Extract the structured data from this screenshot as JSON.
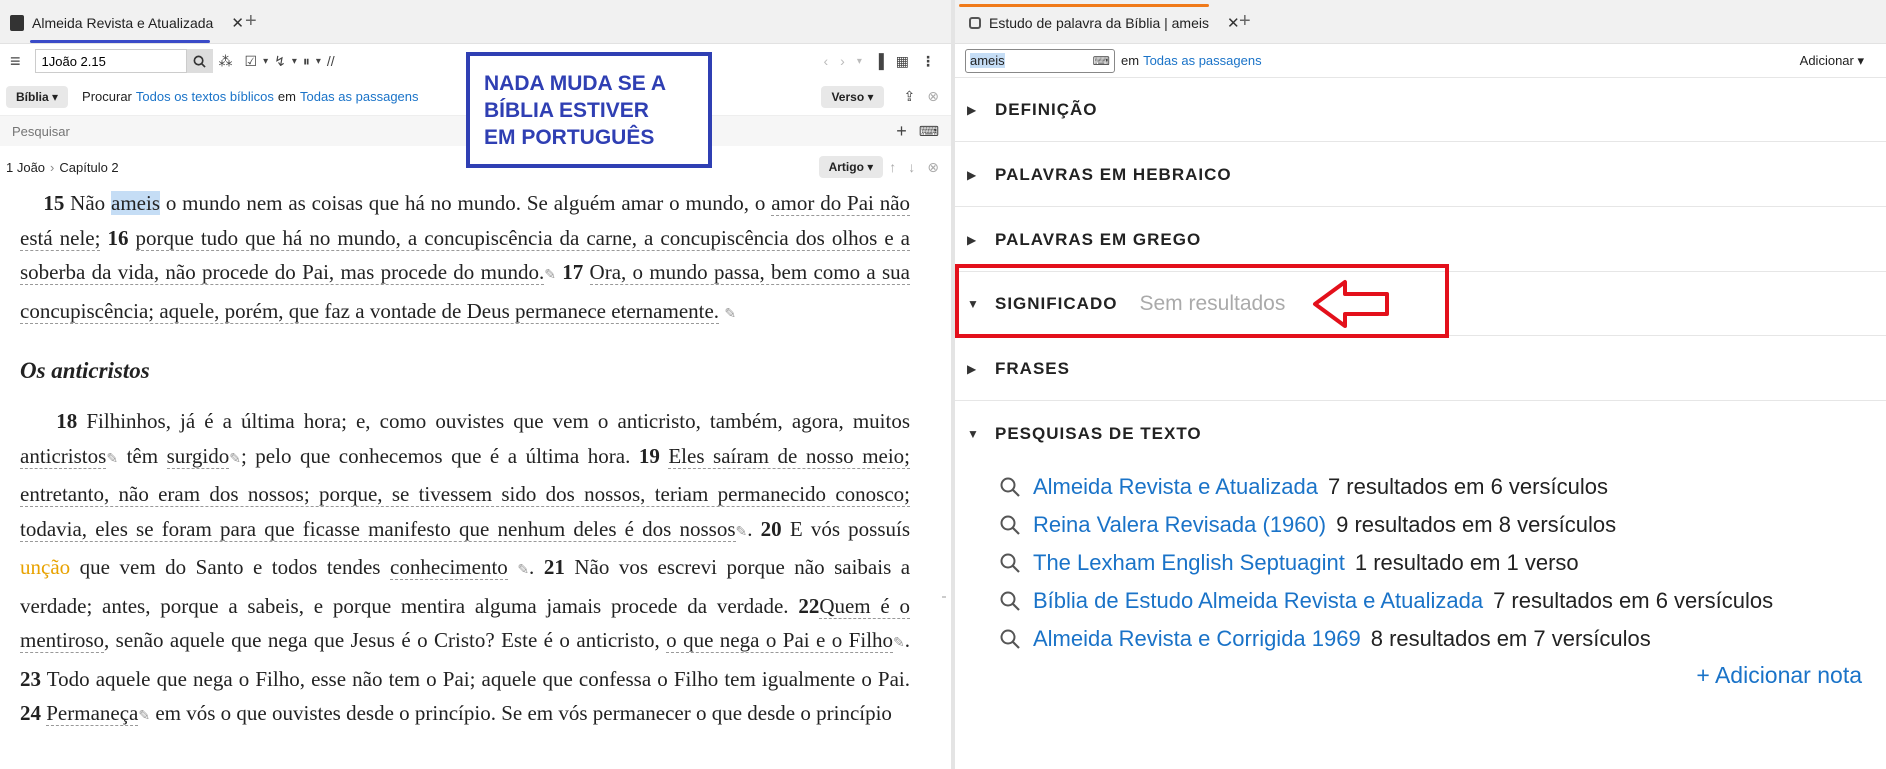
{
  "left": {
    "tab_title": "Almeida Revista e Atualizada",
    "tab_close": "✕",
    "reference": "1João 2.15",
    "toolbar_separator": "//",
    "search_bar": {
      "scope_button": "Bíblia",
      "procurar": "Procurar",
      "search_texts": "Todos os textos bíblicos",
      "em": "em",
      "passages": "Todas as passagens",
      "view_button": "Verso"
    },
    "search_placeholder": "Pesquisar",
    "breadcrumb": {
      "book": "1 João",
      "chapter": "Capítulo 2",
      "view": "Artigo"
    }
  },
  "callout": {
    "line1": "NADA MUDA SE A",
    "line2": "BÍBLIA ESTIVER",
    "line3": "EM PORTUGUÊS"
  },
  "scripture": {
    "p1": {
      "v15": "15",
      "t1": "Não",
      "hl": "ameis",
      "t2": "o mundo nem as coisas que há no mundo. Se alguém amar o mundo, o",
      "d1": "amor do Pai não está nele;",
      "v16": "16",
      "d2": "porque tudo que há no mundo, a concupiscência da carne, a concupiscência dos olhos e a soberba da vida, não procede do Pai, mas procede do mundo.",
      "v17": "17",
      "d3": "Ora, o mundo passa, bem como a sua concupiscência; aquele, porém, que faz a vontade de Deus permanece eternamente."
    },
    "heading": "Os anticristos",
    "p2": {
      "v18": "18",
      "t1": "Filhinhos, já é a última hora; e, como ouvistes que vem o anticristo, também, agora, muitos",
      "d_anticristos": "anticristos",
      "t2": "têm",
      "d_surgido": "surgido",
      "t3": "; pelo que conhecemos que é a última hora.",
      "v19": "19",
      "d4": "Eles saíram de nosso meio; entretanto, não eram dos nossos; porque, se tivessem sido dos nossos, teriam permanecido conosco; todavia, eles se foram para que ficasse manifesto que nenhum deles é dos nossos",
      "t4": ".",
      "v20": "20",
      "t5": "E vós possuís",
      "uncao": "unção",
      "t6": "que vem do Santo e todos tendes",
      "d_conhecimento": "conhecimento",
      "t7": ".",
      "v21": "21",
      "t8": "Não vos escrevi porque não saibais a verdade; antes, porque a sabeis, e porque mentira alguma jamais procede da verdade.",
      "v22": "22",
      "d5": "Quem é o mentiroso",
      "t9": ", senão aquele que nega que Jesus é o Cristo? Este é o anticristo,",
      "d6": "o que nega o Pai e o Filho",
      "t10": ".",
      "v23": "23",
      "t11": "Todo aquele que nega o Filho, esse não tem o Pai; aquele que confessa o Filho tem igualmente o Pai.",
      "v24": "24",
      "d_permaneca": "Permaneça",
      "t12": "em vós o que ouvistes desde o princípio. Se em vós permanecer o que desde o princípio"
    }
  },
  "right": {
    "tab_title": "Estudo de palavra da Bíblia | ameis",
    "tab_close": "✕",
    "word_input": "ameis",
    "em": "em",
    "passages": "Todas as passagens",
    "add_button": "Adicionar",
    "sections": {
      "definicao": "DEFINIÇÃO",
      "hebraico": "PALAVRAS EM HEBRAICO",
      "grego": "PALAVRAS EM GREGO",
      "significado": "SIGNIFICADO",
      "sem_resultados": "Sem resultados",
      "frases": "FRASES",
      "pesquisas": "PESQUISAS DE TEXTO"
    },
    "results": [
      {
        "name": "Almeida Revista e Atualizada",
        "count": "7 resultados em 6 versículos"
      },
      {
        "name": "Reina Valera Revisada (1960)",
        "count": "9 resultados em 8 versículos"
      },
      {
        "name": "The Lexham English Septuagint",
        "count": "1 resultado em 1 verso"
      },
      {
        "name": "Bíblia de Estudo Almeida Revista e Atualizada",
        "count": "7 resultados em 6 versículos"
      },
      {
        "name": "Almeida Revista e Corrigida 1969",
        "count": "8 resultados em 7 versículos"
      }
    ],
    "add_note": "+ Adicionar nota"
  },
  "colors": {
    "accent_blue": "#1a73c8",
    "callout_blue": "#2f3fb3",
    "red_box": "#e3101b",
    "tab_orange": "#f07a1a"
  }
}
